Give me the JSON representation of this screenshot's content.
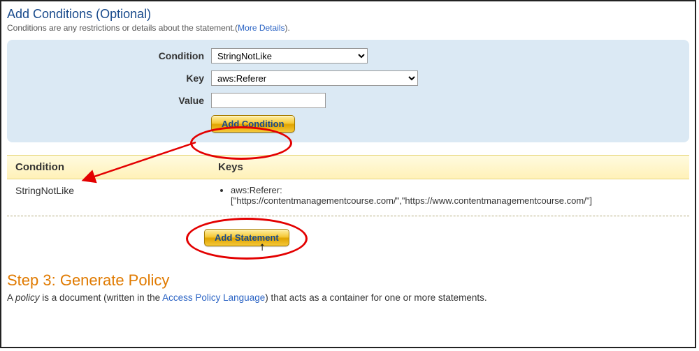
{
  "conditions_section": {
    "title": "Add Conditions (Optional)",
    "description_prefix": "Conditions are any restrictions or details about the statement.(",
    "more_details": "More Details",
    "description_suffix": ").",
    "labels": {
      "condition": "Condition",
      "key": "Key",
      "value": "Value"
    },
    "condition_selected": "StringNotLike",
    "key_selected": "aws:Referer",
    "value_input": "",
    "add_condition_btn": "Add Condition"
  },
  "conditions_table": {
    "headers": {
      "condition": "Condition",
      "keys": "Keys"
    },
    "row": {
      "condition_value": "StringNotLike",
      "key_line1": "aws:Referer:",
      "key_line2": "[\"https://contentmanagementcourse.com/\",\"https://www.contentmanagementcourse.com/\"]"
    }
  },
  "add_statement_btn": "Add Statement",
  "step3": {
    "title": "Step 3: Generate Policy",
    "prefix": "A ",
    "policy_word": "policy",
    "mid1": " is a document (written in the ",
    "link": "Access Policy Language",
    "suffix": ") that acts as a container for one or more statements."
  }
}
